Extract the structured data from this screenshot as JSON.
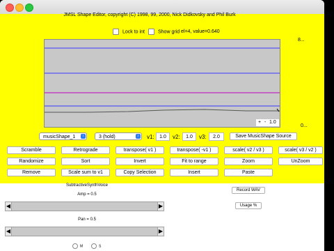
{
  "window": {
    "controls": [
      "close",
      "minimize",
      "maximize"
    ]
  },
  "editor": {
    "title": "JMSL Shape Editor, copyright (C) 1998, 99, 2000, Nick Didkovsky and Phil Burk",
    "lock_to_int_label": "Lock to int",
    "show_grid_label": "Show grid",
    "status": "el=4, value=0.640",
    "axis_max": "8...",
    "axis_min": "0...",
    "zoom": {
      "plus": "+",
      "minus": "-",
      "value": "1.0"
    },
    "colors": {
      "background": "#ffff00",
      "plot": "#c8c8c8",
      "blue_line": "#3838ff",
      "magenta_line": "#c000c0"
    },
    "shape_select": "musicShape_1",
    "hold_select": "3 (hold)",
    "v1_label": "v1:",
    "v1_value": "1.0",
    "v2_label": "v2:",
    "v2_value": "1.0",
    "v3_label": "v3:",
    "v3_value": "2.0",
    "save_button": "Save MusicShape Source",
    "buttons": {
      "scramble": "Scramble",
      "retrograde": "Retrograde",
      "transpose_v1": "transpose( v1 )",
      "transpose_neg_v1": "transpose( -v1 )",
      "scale_v2_v3": "scale( v2 / v3 )",
      "scale_v3_v2": "scale( v3 / v2 )",
      "randomize": "Randomize",
      "sort": "Sort",
      "invert": "Invert",
      "fit_to_range": "Fit to range",
      "zoom": "Zoom",
      "unzoom": "UnZoom",
      "remove": "Remove",
      "scale_sum": "Scale sum to v1",
      "copy_selection": "Copy Selection",
      "insert": "Insert",
      "paste": "Paste"
    }
  },
  "synth": {
    "title": "SubtractiveSynthVoice",
    "amp_label": "Amp = 0.5",
    "amp_value": 0.5,
    "pan_label": "Pan = 0.5",
    "pan_value": 0.5,
    "record_button": "Record WAV",
    "usage_button": "Usage %",
    "radio_m": "M",
    "radio_s": "S"
  }
}
